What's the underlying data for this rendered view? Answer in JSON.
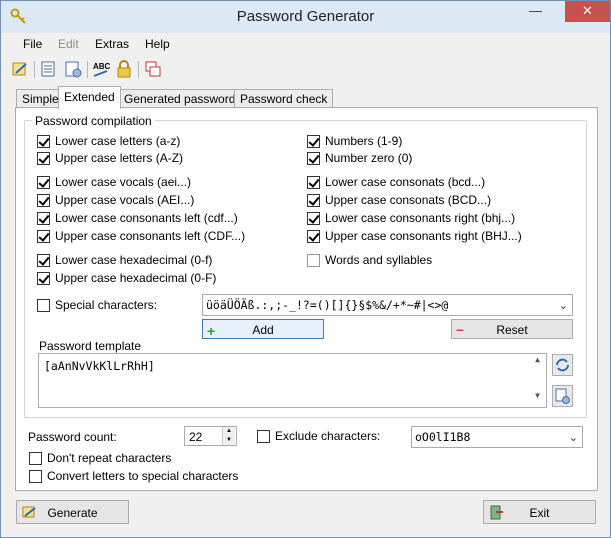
{
  "window": {
    "title": "Password Generator"
  },
  "menu": [
    "File",
    "Edit",
    "Extras",
    "Help"
  ],
  "tabs": [
    "Simple",
    "Extended",
    "Generated passwords",
    "Password check"
  ],
  "group": {
    "title": "Password compilation"
  },
  "checks_left": [
    {
      "label": "Lower case letters (a-z)",
      "checked": true
    },
    {
      "label": "Upper case letters (A-Z)",
      "checked": true
    },
    {
      "label": "Lower case vocals (aei...)",
      "checked": true
    },
    {
      "label": "Upper case vocals (AEI...)",
      "checked": true
    },
    {
      "label": "Lower case consonants left (cdf...)",
      "checked": true
    },
    {
      "label": "Upper case consonants left (CDF...)",
      "checked": true
    },
    {
      "label": "Lower case hexadecimal (0-f)",
      "checked": true
    },
    {
      "label": "Upper case hexadecimal (0-F)",
      "checked": true
    }
  ],
  "checks_right": [
    {
      "label": "Numbers (1-9)",
      "checked": true
    },
    {
      "label": "Number zero (0)",
      "checked": true
    },
    {
      "label": "Lower case consonats (bcd...)",
      "checked": true
    },
    {
      "label": "Upper case consonats (BCD...)",
      "checked": true
    },
    {
      "label": "Lower case consonants right (bhj...)",
      "checked": true
    },
    {
      "label": "Upper case consonants right (BHJ...)",
      "checked": true
    },
    {
      "label": "Words and syllables",
      "checked": false
    }
  ],
  "special": {
    "label": "Special characters:",
    "checked": false,
    "value": "üöäÜÖÄß.:,;-_!?=()[]{}§$%&/+*~#|<>@"
  },
  "buttons": {
    "add": "Add",
    "reset": "Reset",
    "generate": "Generate",
    "exit": "Exit"
  },
  "template": {
    "label": "Password template",
    "value": "[aAnNvVkKlLrRhH]"
  },
  "count": {
    "label": "Password count:",
    "value": "22"
  },
  "exclude": {
    "label": "Exclude characters:",
    "checked": false,
    "value": "oO0lI1B8"
  },
  "options": [
    {
      "label": "Don't repeat characters",
      "checked": false
    },
    {
      "label": "Convert letters to special characters",
      "checked": false
    }
  ]
}
